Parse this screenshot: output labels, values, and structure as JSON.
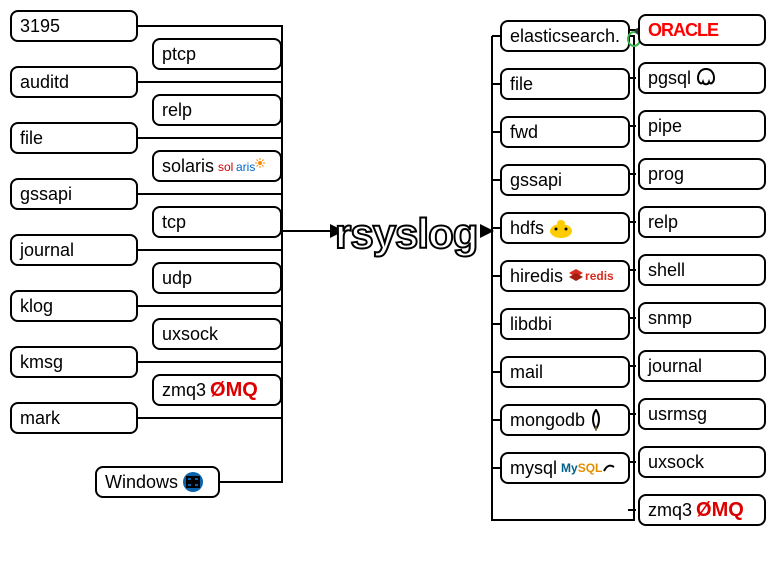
{
  "center": "rsyslog",
  "left_col_a": [
    "3195",
    "auditd",
    "file",
    "gssapi",
    "journal",
    "klog",
    "kmsg",
    "mark"
  ],
  "left_col_b": [
    {
      "label": "ptcp",
      "icon": null
    },
    {
      "label": "relp",
      "icon": null
    },
    {
      "label": "solaris",
      "icon": "solaris"
    },
    {
      "label": "tcp",
      "icon": null
    },
    {
      "label": "udp",
      "icon": null
    },
    {
      "label": "uxsock",
      "icon": null
    },
    {
      "label": "zmq3",
      "icon": "zmq"
    }
  ],
  "left_bottom": {
    "label": "Windows",
    "icon": "windows"
  },
  "right_col_a": [
    {
      "label": "elasticsearch.",
      "icon": "elastic"
    },
    {
      "label": "file",
      "icon": null
    },
    {
      "label": "fwd",
      "icon": null
    },
    {
      "label": "gssapi",
      "icon": null
    },
    {
      "label": "hdfs",
      "icon": "hadoop"
    },
    {
      "label": "hiredis",
      "icon": "redis"
    },
    {
      "label": "libdbi",
      "icon": null
    },
    {
      "label": "mail",
      "icon": null
    },
    {
      "label": "mongodb",
      "icon": "mongo"
    },
    {
      "label": "mysql",
      "icon": "mysql"
    }
  ],
  "right_col_b": [
    {
      "label": "ORACLE",
      "icon": null,
      "brand": "oracle"
    },
    {
      "label": "pgsql",
      "icon": "postgres"
    },
    {
      "label": "pipe",
      "icon": null
    },
    {
      "label": "prog",
      "icon": null
    },
    {
      "label": "relp",
      "icon": null
    },
    {
      "label": "shell",
      "icon": null
    },
    {
      "label": "snmp",
      "icon": null
    },
    {
      "label": "journal",
      "icon": null
    },
    {
      "label": "usrmsg",
      "icon": null
    },
    {
      "label": "uxsock",
      "icon": null
    },
    {
      "label": "zmq3",
      "icon": "zmq"
    }
  ]
}
